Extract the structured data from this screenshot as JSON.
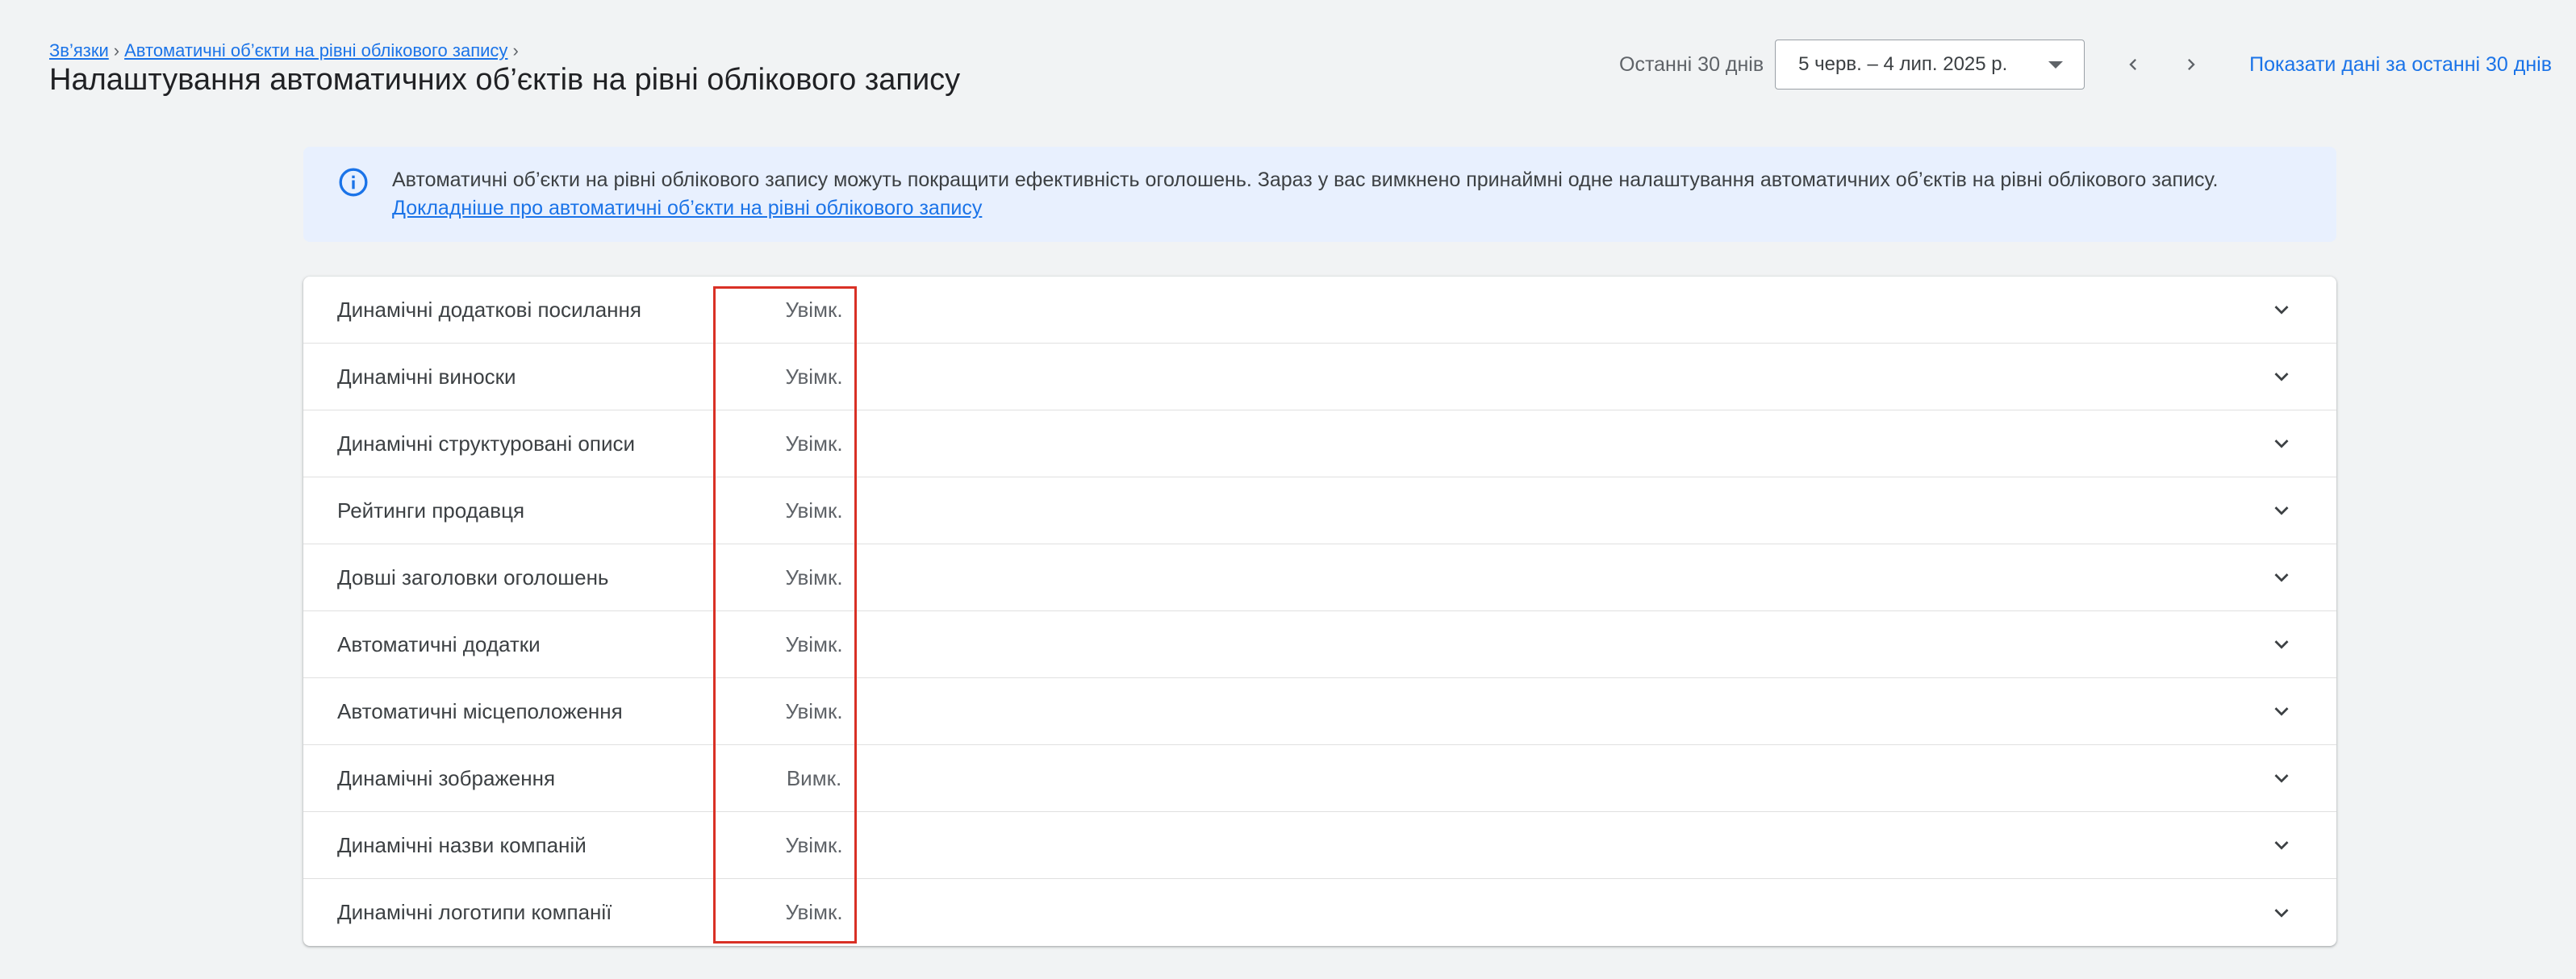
{
  "breadcrumb": {
    "items": [
      "Зв’язки",
      "Автоматичні об’єкти на рівні облікового запису"
    ]
  },
  "page": {
    "title": "Налаштування автоматичних об’єктів на рівні облікового запису"
  },
  "date_range": {
    "label": "Останні 30 днів",
    "value": "5 черв. – 4 лип. 2025 р.",
    "show_last_link": "Показати дані за останні 30 днів"
  },
  "banner": {
    "text": "Автоматичні об’єкти на рівні облікового запису можуть покращити ефективність оголошень. Зараз у вас вимкнено принаймні одне налаштування автоматичних об’єктів на рівні облікового запису.",
    "link": "Докладніше про автоматичні об’єкти на рівні облікового запису"
  },
  "settings": [
    {
      "name": "Динамічні додаткові посилання",
      "status": "Увімк."
    },
    {
      "name": "Динамічні виноски",
      "status": "Увімк."
    },
    {
      "name": "Динамічні структуровані описи",
      "status": "Увімк."
    },
    {
      "name": "Рейтинги продавця",
      "status": "Увімк."
    },
    {
      "name": "Довші заголовки оголошень",
      "status": "Увімк."
    },
    {
      "name": "Автоматичні додатки",
      "status": "Увімк."
    },
    {
      "name": "Автоматичні місцеположення",
      "status": "Увімк."
    },
    {
      "name": "Динамічні зображення",
      "status": "Вимк."
    },
    {
      "name": "Динамічні назви компаній",
      "status": "Увімк."
    },
    {
      "name": "Динамічні логотипи компанії",
      "status": "Увімк."
    }
  ],
  "colors": {
    "accent": "#1a73e8",
    "banner_bg": "#e8f0fe",
    "highlight_border": "#d93025"
  }
}
